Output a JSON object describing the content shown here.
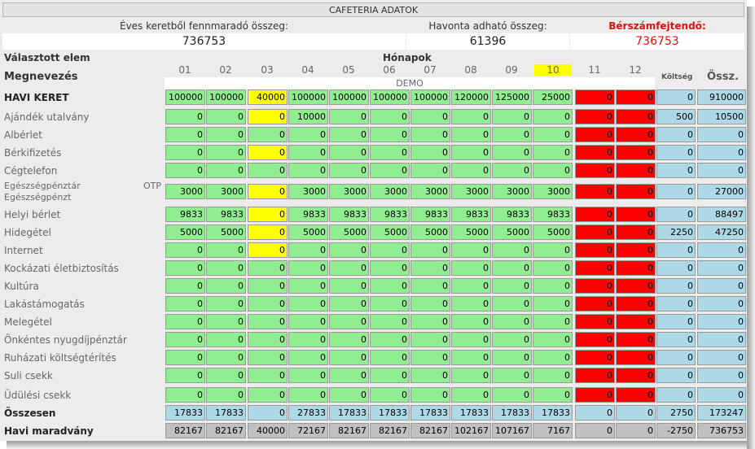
{
  "title": "CAFETERIA ADATOK",
  "summary": {
    "annual_remaining_label": "Éves keretből fennmaradó összeg:",
    "annual_remaining_value": "736753",
    "monthly_label": "Havonta adható összeg:",
    "monthly_value": "61396",
    "payroll_label": "Bérszámfejtendő:",
    "payroll_value": "736753"
  },
  "table": {
    "selected_label": "Választott elem",
    "months_label": "Hónapok",
    "name_label": "Megnevezés",
    "months": [
      "01",
      "02",
      "03",
      "04",
      "05",
      "06",
      "07",
      "08",
      "09",
      "10",
      "11",
      "12"
    ],
    "cost_label": "Költség",
    "total_label": "Össz.",
    "demo_label": "DEMO",
    "rows": [
      {
        "name": "HAVI KERET",
        "kind": "bold",
        "values": [
          "100000",
          "100000",
          "40000",
          "100000",
          "100000",
          "100000",
          "100000",
          "120000",
          "125000",
          "25000",
          "0",
          "0"
        ],
        "cost": "0",
        "total": "910000"
      },
      {
        "name": "Ajándék utalvány",
        "kind": "item",
        "values": [
          "0",
          "0",
          "0",
          "10000",
          "0",
          "0",
          "0",
          "0",
          "0",
          "0",
          "0",
          "0"
        ],
        "cost": "500",
        "total": "10500"
      },
      {
        "name": "Albérlet",
        "kind": "item",
        "values": [
          "0",
          "0",
          "0",
          "0",
          "0",
          "0",
          "0",
          "0",
          "0",
          "0",
          "0",
          "0"
        ],
        "cost": "0",
        "total": "0"
      },
      {
        "name": "Bérkifizetés",
        "kind": "item",
        "values": [
          "0",
          "0",
          "0",
          "0",
          "0",
          "0",
          "0",
          "0",
          "0",
          "0",
          "0",
          "0"
        ],
        "cost": "0",
        "total": "0"
      },
      {
        "name": "Cégtelefon",
        "kind": "item",
        "values": [
          "0",
          "0",
          "0",
          "0",
          "0",
          "0",
          "0",
          "0",
          "0",
          "0",
          "0",
          "0"
        ],
        "cost": "0",
        "total": "0"
      },
      {
        "name": "Egészségpénztár",
        "name2": "Egészségpénzt",
        "tag": "OTP",
        "kind": "item",
        "values": [
          "3000",
          "3000",
          "0",
          "3000",
          "3000",
          "3000",
          "3000",
          "3000",
          "3000",
          "3000",
          "0",
          "0"
        ],
        "cost": "0",
        "total": "27000"
      },
      {
        "name": "Helyi bérlet",
        "kind": "item",
        "values": [
          "9833",
          "9833",
          "0",
          "9833",
          "9833",
          "9833",
          "9833",
          "9833",
          "9833",
          "9833",
          "0",
          "0"
        ],
        "cost": "0",
        "total": "88497"
      },
      {
        "name": "Hidegétel",
        "kind": "item",
        "values": [
          "5000",
          "5000",
          "0",
          "5000",
          "5000",
          "5000",
          "5000",
          "5000",
          "5000",
          "5000",
          "0",
          "0"
        ],
        "cost": "2250",
        "total": "47250"
      },
      {
        "name": "Internet",
        "kind": "item",
        "values": [
          "0",
          "0",
          "0",
          "0",
          "0",
          "0",
          "0",
          "0",
          "0",
          "0",
          "0",
          "0"
        ],
        "cost": "0",
        "total": "0"
      },
      {
        "name": "Kockázati életbiztosítás",
        "kind": "item",
        "values": [
          "0",
          "0",
          "0",
          "0",
          "0",
          "0",
          "0",
          "0",
          "0",
          "0",
          "0",
          "0"
        ],
        "cost": "0",
        "total": "0"
      },
      {
        "name": "Kultúra",
        "kind": "item",
        "values": [
          "0",
          "0",
          "0",
          "0",
          "0",
          "0",
          "0",
          "0",
          "0",
          "0",
          "0",
          "0"
        ],
        "cost": "0",
        "total": "0"
      },
      {
        "name": "Lakástámogatás",
        "kind": "item",
        "values": [
          "0",
          "0",
          "0",
          "0",
          "0",
          "0",
          "0",
          "0",
          "0",
          "0",
          "0",
          "0"
        ],
        "cost": "0",
        "total": "0"
      },
      {
        "name": "Melegétel",
        "kind": "item",
        "values": [
          "0",
          "0",
          "0",
          "0",
          "0",
          "0",
          "0",
          "0",
          "0",
          "0",
          "0",
          "0"
        ],
        "cost": "0",
        "total": "0"
      },
      {
        "name": "Önkéntes nyugdíjpénztár",
        "kind": "item",
        "values": [
          "0",
          "0",
          "0",
          "0",
          "0",
          "0",
          "0",
          "0",
          "0",
          "0",
          "0",
          "0"
        ],
        "cost": "0",
        "total": "0"
      },
      {
        "name": "Ruházati költségtérítés",
        "kind": "item",
        "values": [
          "0",
          "0",
          "0",
          "0",
          "0",
          "0",
          "0",
          "0",
          "0",
          "0",
          "0",
          "0"
        ],
        "cost": "0",
        "total": "0"
      },
      {
        "name": "Suli csekk",
        "kind": "item",
        "values": [
          "0",
          "0",
          "0",
          "0",
          "0",
          "0",
          "0",
          "0",
          "0",
          "0",
          "0",
          "0"
        ],
        "cost": "0",
        "total": "0"
      },
      {
        "name": "Üdülési csekk",
        "kind": "item",
        "values": [
          "0",
          "0",
          "0",
          "0",
          "0",
          "0",
          "0",
          "0",
          "0",
          "0",
          "0",
          "0"
        ],
        "cost": "0",
        "total": "0"
      },
      {
        "name": "Összesen",
        "kind": "sum",
        "values": [
          "17833",
          "17833",
          "0",
          "27833",
          "17833",
          "17833",
          "17833",
          "17833",
          "17833",
          "17833",
          "0",
          "0"
        ],
        "cost": "2750",
        "total": "173247"
      },
      {
        "name": "Havi maradvány",
        "kind": "rest",
        "values": [
          "82167",
          "82167",
          "40000",
          "72167",
          "82167",
          "82167",
          "82167",
          "102167",
          "107167",
          "7167",
          "0",
          "0"
        ],
        "cost": "-2750",
        "total": "736753"
      }
    ]
  },
  "colors": {
    "green": "#90ee90",
    "yellow": "#ffff00",
    "red": "#ff0000",
    "blue": "#add8e6",
    "grey": "#c0c0c0",
    "header_grey": "#e2e2e2"
  }
}
